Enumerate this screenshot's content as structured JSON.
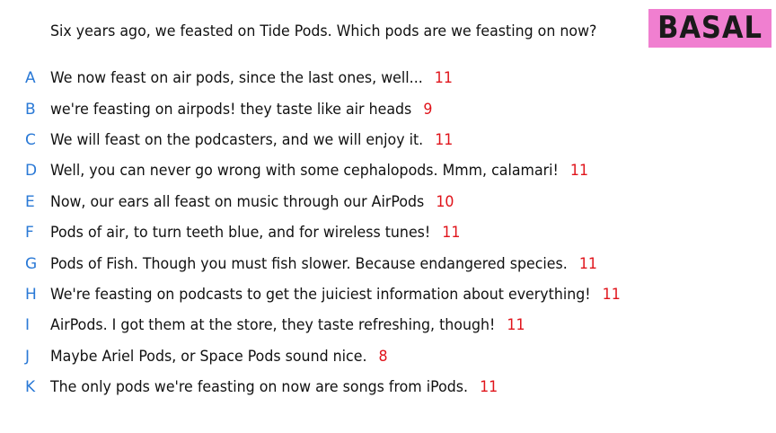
{
  "question": "Six years ago, we feasted on Tide Pods. Which pods are we feasting on now?",
  "badge": {
    "label": "BASAL",
    "color": "#f07fd0"
  },
  "colors": {
    "letter": "#2a79d6",
    "score": "#e0141b",
    "text": "#111111"
  },
  "answers": [
    {
      "letter": "A",
      "text": "We now feast on air pods, since the last ones, well...",
      "score": "11"
    },
    {
      "letter": "B",
      "text": "we're feasting on airpods! they taste like air heads",
      "score": "9"
    },
    {
      "letter": "C",
      "text": "We will feast on the podcasters, and we will enjoy it.",
      "score": "11"
    },
    {
      "letter": "D",
      "text": "Well, you can never go wrong with some cephalopods. Mmm, calamari!",
      "score": "11"
    },
    {
      "letter": "E",
      "text": "Now, our ears all feast on music through our AirPods",
      "score": "10"
    },
    {
      "letter": "F",
      "text": "Pods of air, to turn teeth blue, and for wireless tunes!",
      "score": "11"
    },
    {
      "letter": "G",
      "text": "Pods of Fish. Though you must fish slower. Because endangered species.",
      "score": "11"
    },
    {
      "letter": "H",
      "text": "We're feasting on podcasts to get the juiciest information about everything!",
      "score": "11"
    },
    {
      "letter": "I",
      "text": "AirPods. I got them at the store, they taste refreshing, though!",
      "score": "11"
    },
    {
      "letter": "J",
      "text": "Maybe Ariel Pods, or Space Pods sound nice.",
      "score": "8"
    },
    {
      "letter": "K",
      "text": "The only pods we're feasting on now are songs from iPods.",
      "score": "11"
    }
  ]
}
